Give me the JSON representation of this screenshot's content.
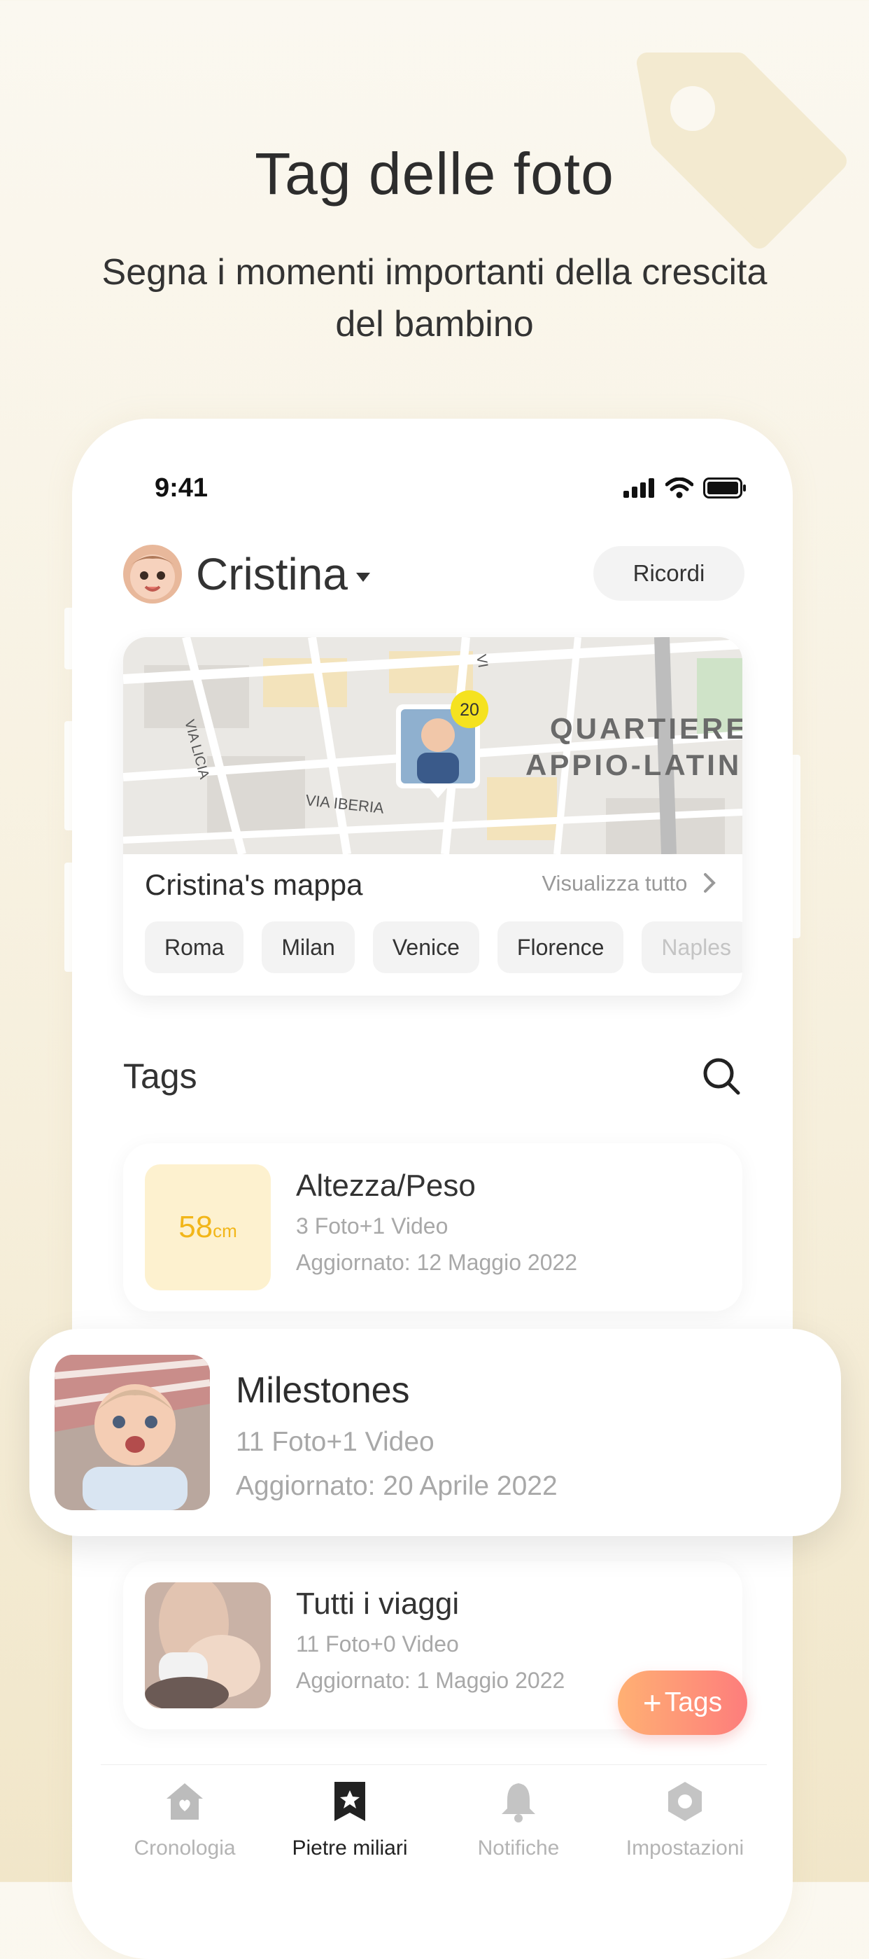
{
  "hero": {
    "title": "Tag delle foto",
    "subtitle": "Segna i momenti importanti della crescita del bambino"
  },
  "status_bar": {
    "time": "9:41"
  },
  "profile": {
    "name": "Cristina",
    "memories_button": "Ricordi"
  },
  "map": {
    "title": "Cristina's mappa",
    "see_all": "Visualizza tutto",
    "photo_count": "20",
    "labels": {
      "district_line1": "QUARTIERE",
      "district_line2": "APPIO-LATIN",
      "street1": "VIA IBERIA",
      "street2": "VIA LICIA",
      "street3": "VI"
    },
    "cities": [
      "Roma",
      "Milan",
      "Venice",
      "Florence",
      "Naples"
    ]
  },
  "tags_section": {
    "title": "Tags"
  },
  "tags": [
    {
      "title": "Altezza/Peso",
      "meta": "3 Foto+1 Video",
      "date": "Aggiornato: 12 Maggio 2022",
      "thumb_value": "58",
      "thumb_unit": "cm"
    },
    {
      "title": "Milestones",
      "meta": "11 Foto+1 Video",
      "date": "Aggiornato: 20 Aprile 2022"
    },
    {
      "title": "Tutti i viaggi",
      "meta": "11 Foto+0 Video",
      "date": "Aggiornato: 1 Maggio 2022"
    }
  ],
  "fab": {
    "plus": "+",
    "label": "Tags"
  },
  "tabbar": {
    "items": [
      {
        "label": "Cronologia",
        "icon": "home-icon"
      },
      {
        "label": "Pietre miliari",
        "icon": "bookmark-star-icon"
      },
      {
        "label": "Notifiche",
        "icon": "bell-icon"
      },
      {
        "label": "Impostazioni",
        "icon": "settings-icon"
      }
    ],
    "active": "Pietre miliari"
  },
  "colors": {
    "accent_yellow": "#f5c332",
    "fab_start": "#ffb073",
    "fab_end": "#fd7d7c",
    "tag_thumb_bg": "#fdf1cf"
  }
}
